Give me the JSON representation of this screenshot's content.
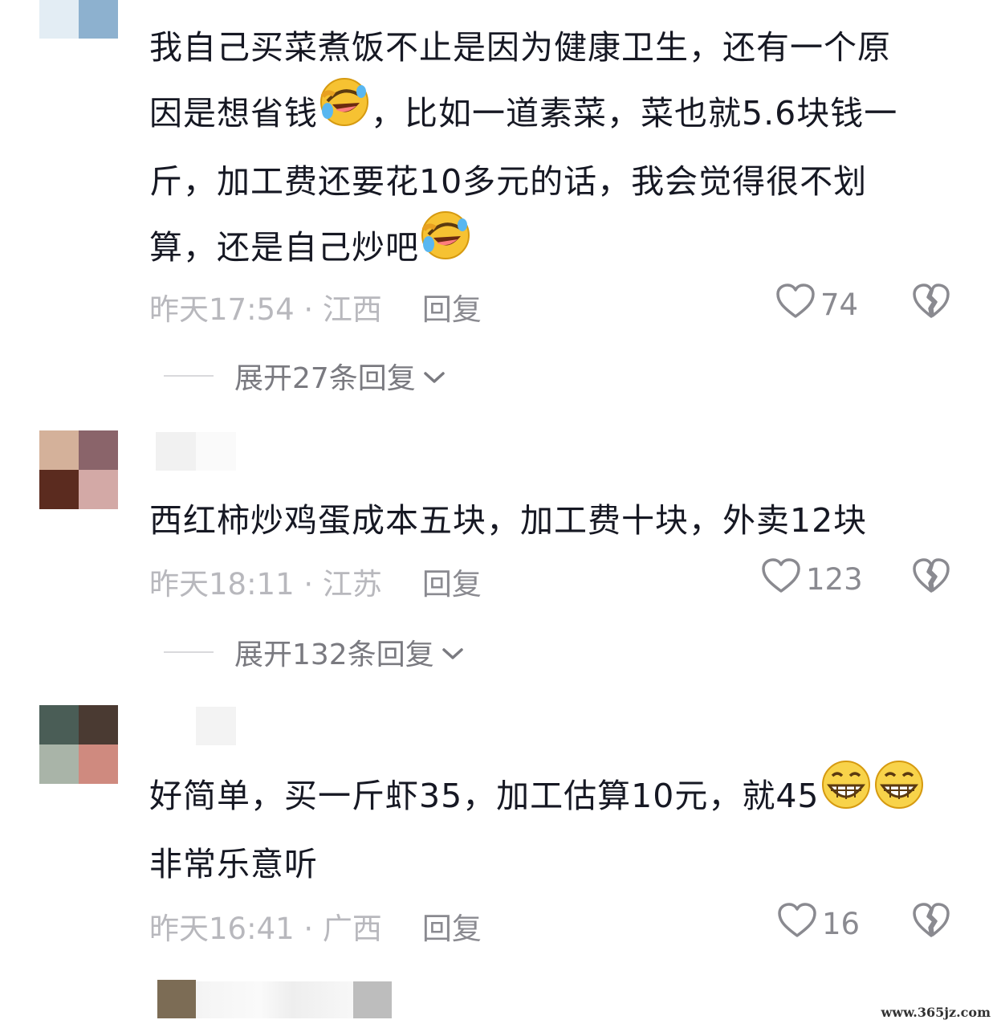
{
  "comments": [
    {
      "text_lines": [
        "我自己买菜煮饭不止是因为健康卫生，还有一个原",
        "因是想省钱",
        "，比如一道素菜，菜也就5.6块钱一",
        "斤，加工费还要花10多元的话，我会觉得很不划",
        "算，还是自己炒吧"
      ],
      "time_location": "昨天17:54 · 江西",
      "reply_label": "回复",
      "likes": "74",
      "expand_label": "展开27条回复"
    },
    {
      "text": "西红柿炒鸡蛋成本五块，加工费十块，外卖12块",
      "time_location": "昨天18:11 · 江苏",
      "reply_label": "回复",
      "likes": "123",
      "expand_label": "展开132条回复"
    },
    {
      "text_line1": "好简单，买一斤虾35，加工估算10元，就45",
      "text_line2": "非常乐意听",
      "time_location": "昨天16:41 · 广西",
      "reply_label": "回复",
      "likes": "16"
    }
  ],
  "icons": {
    "like": "heart-outline-icon",
    "dislike": "broken-heart-icon",
    "expand": "chevron-down-icon",
    "emoji_laugh": "rofl-emoji",
    "emoji_grin": "grin-emoji"
  },
  "colors": {
    "text": "#161823",
    "meta": "#b8b8bd",
    "secondary": "#8a8a90"
  },
  "watermark": "www.365jz.com"
}
